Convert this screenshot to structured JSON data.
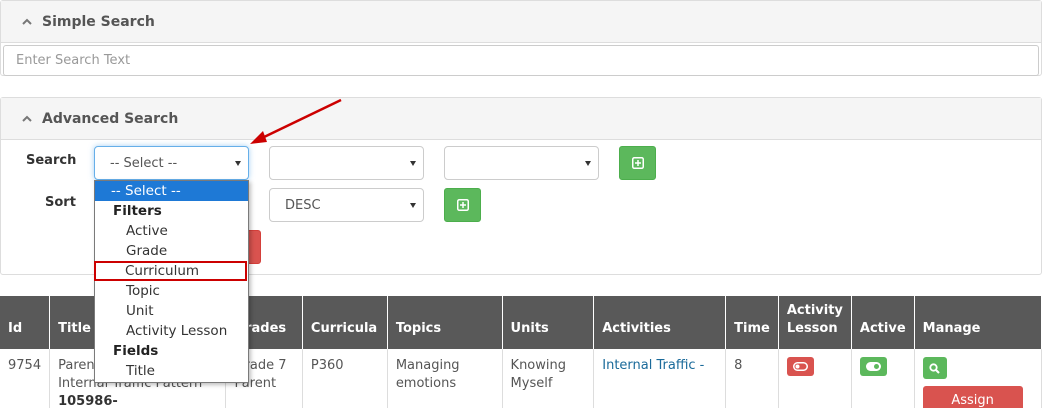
{
  "simple_search": {
    "title": "Simple Search",
    "placeholder": "Enter Search Text"
  },
  "advanced_search": {
    "title": "Advanced Search",
    "search_label": "Search",
    "sort_label": "Sort",
    "search_field_value": "-- Select --",
    "search_operator_value": "",
    "search_value_value": "",
    "sort_field_value": "",
    "sort_direction_value": "DESC",
    "dropdown_options": [
      {
        "kind": "option",
        "label": "-- Select --",
        "selected": true
      },
      {
        "kind": "group",
        "label": "Filters"
      },
      {
        "kind": "option",
        "label": "Active"
      },
      {
        "kind": "option",
        "label": "Grade"
      },
      {
        "kind": "option",
        "label": "Curriculum",
        "highlighted": true
      },
      {
        "kind": "option",
        "label": "Topic"
      },
      {
        "kind": "option",
        "label": "Unit"
      },
      {
        "kind": "option",
        "label": "Activity Lesson"
      },
      {
        "kind": "group",
        "label": "Fields"
      },
      {
        "kind": "option",
        "label": "Title"
      }
    ]
  },
  "table": {
    "headers": [
      "Id",
      "Title",
      "Grades",
      "Curricula",
      "Topics",
      "Units",
      "Activities",
      "Time",
      "Activity Lesson",
      "Active",
      "Manage"
    ],
    "rows": [
      {
        "id": "9754",
        "title_line1": "Parent",
        "title_line2": "Internal Traffic Pattern",
        "title_line3": "105986-",
        "grades": "Grade 7 Parent",
        "curricula": "P360",
        "topics": "Managing emotions",
        "units": "Knowing Myself",
        "activities": "Internal Traffic -",
        "time": "8",
        "assign_label": "Assign"
      }
    ]
  },
  "colors": {
    "header_bg": "#595959",
    "green": "#5cb85c",
    "red": "#d9534f",
    "select_highlight": "#1e79d6",
    "annotation_red": "#cc0000"
  }
}
